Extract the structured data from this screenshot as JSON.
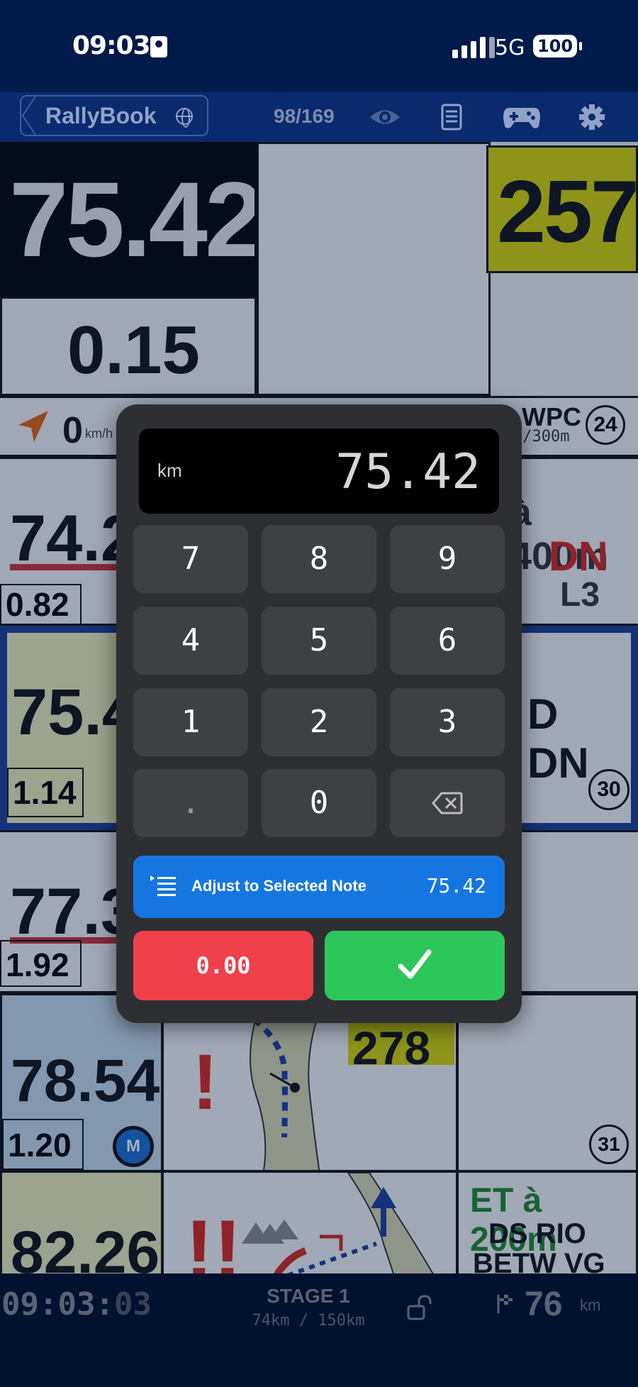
{
  "status_bar": {
    "time": "09:03",
    "network": "5G",
    "battery": "100"
  },
  "toolbar": {
    "brand": "RallyBook",
    "counter": "98/169",
    "icons": [
      "globe-icon",
      "eye-icon",
      "roadbook-icon",
      "gamepad-icon",
      "gear-icon"
    ]
  },
  "dashboard": {
    "total_distance": "75.42",
    "partial_distance": "0.15",
    "heading": "257",
    "speed": "0",
    "speed_unit": "km/h",
    "wpc_label": "WPC",
    "wpc_distance": "-/300m",
    "wpc_number": "24",
    "note_rows": [
      {
        "km": "74.2",
        "partial": "0.82",
        "text1": "à 400m",
        "text2": "DN",
        "text3": "L3"
      },
      {
        "km": "75.4",
        "partial": "1.14",
        "text1": "D DN",
        "badge": "30"
      },
      {
        "km": "77.3",
        "partial": "1.92"
      },
      {
        "km": "78.54",
        "partial": "1.20",
        "badge_letter": "M",
        "heading": "278",
        "badge": "31"
      },
      {
        "km": "82.26",
        "text1": "ET à 200m",
        "text2": "DS RIO",
        "text3": "BETW VG"
      }
    ]
  },
  "keypad": {
    "unit": "km",
    "value": "75.42",
    "keys": [
      "7",
      "8",
      "9",
      "4",
      "5",
      "6",
      "1",
      "2",
      "3",
      ".",
      "0"
    ],
    "adjust_label": "Adjust to Selected Note",
    "adjust_value": "75.42",
    "reset_label": "0.00"
  },
  "bottom_bar": {
    "time_hm": "09:03:",
    "time_s": "03",
    "stage": "STAGE 1",
    "stage_distance": "74km / 150km",
    "odometer": "76",
    "odometer_unit": "km"
  },
  "colors": {
    "accent_blue": "#1676e0",
    "reset_red": "#f0404a",
    "ok_green": "#2dc65a",
    "heading_yellow": "#d6d600"
  }
}
